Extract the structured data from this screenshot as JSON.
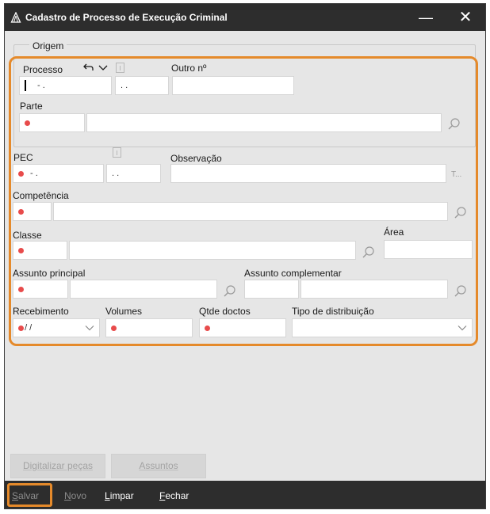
{
  "window": {
    "title": "Cadastro de Processo de Execução Criminal"
  },
  "origem": {
    "legend": "Origem",
    "processo_label": "Processo",
    "processo_value": "- .",
    "processo_value2": ". .",
    "outro_label": "Outro nº",
    "parte_label": "Parte"
  },
  "pec": {
    "label": "PEC",
    "value": "- .",
    "value2": ". .",
    "observacao_label": "Observação",
    "obs_more": "T..."
  },
  "competencia": {
    "label": "Competência"
  },
  "classe": {
    "label": "Classe",
    "area_label": "Área"
  },
  "assunto": {
    "principal_label": "Assunto principal",
    "complementar_label": "Assunto complementar"
  },
  "recebimento": {
    "label": "Recebimento",
    "value": "/ /"
  },
  "volumes": {
    "label": "Volumes"
  },
  "qtde": {
    "label": "Qtde doctos"
  },
  "distribuicao": {
    "label": "Tipo de distribuição"
  },
  "buttons": {
    "digitalizar": "Digitalizar peças",
    "assuntos": "Assuntos"
  },
  "bottombar": {
    "salvar": {
      "first": "S",
      "rest": "alvar"
    },
    "novo": {
      "first": "N",
      "rest": "ovo"
    },
    "limpar": {
      "first": "L",
      "rest": "impar"
    },
    "fechar": {
      "first": "F",
      "rest": "echar"
    }
  },
  "colors": {
    "required_dot": "#e84b4b",
    "highlight": "#e58a2b",
    "titlebar": "#2d2d2d"
  },
  "icons": [
    "app-icon",
    "minimize-icon",
    "close-icon",
    "undo-icon",
    "chevron-down-icon",
    "info-icon",
    "search-icon"
  ]
}
